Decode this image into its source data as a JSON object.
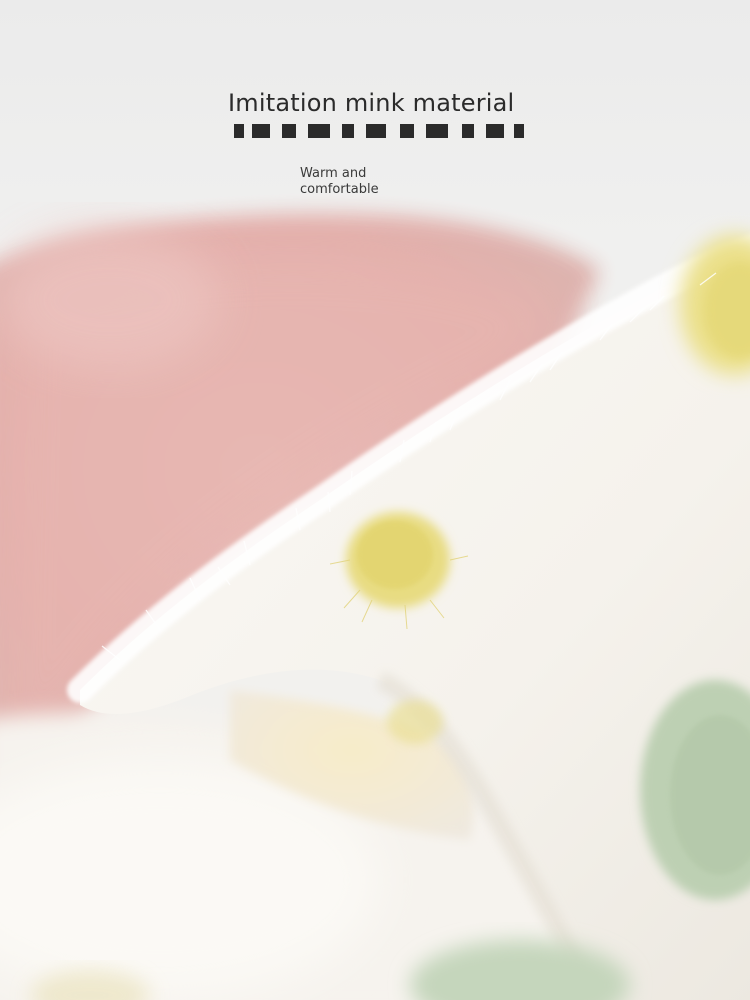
{
  "headline": {
    "text": "Imitation mink material"
  },
  "subtitle": {
    "line1": "Warm and",
    "line2": "comfortable"
  },
  "photo": {
    "subject": "fluffy faux-mink knit fabric",
    "colors": {
      "background": "#efefef",
      "pink_fabric": "#e8b8b4",
      "white_fabric": "#f7f4ef",
      "yellow_dot": "#e6da7c",
      "green_dot": "#b9cdb0"
    }
  }
}
